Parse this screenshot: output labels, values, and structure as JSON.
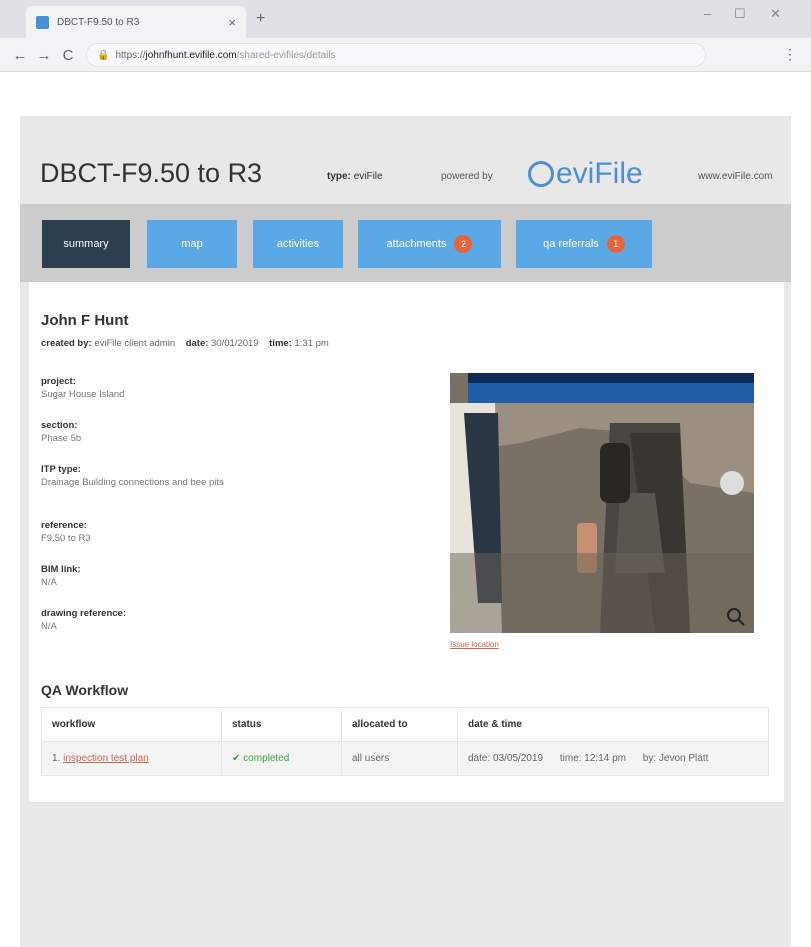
{
  "browser": {
    "tab_title": "DBCT-F9.50 to R3",
    "tab_close": "×",
    "new_tab": "+",
    "window_min": "–",
    "window_max": "☐",
    "window_close": "✕",
    "back": "←",
    "forward": "→",
    "reload": "C",
    "url_scheme": "https://",
    "url_host": "johnfhunt.evifile.com",
    "url_path": "/shared-evifiles/details",
    "menu": "⋮"
  },
  "header": {
    "title": "DBCT-F9.50 to R3",
    "type_label": "type:",
    "type_value": "eviFile",
    "powered_by": "powered by",
    "logo_text": "eviFile",
    "site": "www.eviFile.com",
    "brand_color": "#4a90d9"
  },
  "nav": {
    "tabs": [
      {
        "label": "summary",
        "active": true
      },
      {
        "label": "map"
      },
      {
        "label": "activities"
      },
      {
        "label": "attachments",
        "badge": "2"
      },
      {
        "label": "qa referrals",
        "badge": "1"
      }
    ],
    "active_color": "#2c3e50",
    "tab_color": "#5aa9e6",
    "badge_color": "#e8633a"
  },
  "summary": {
    "name": "John F Hunt",
    "created_by_label": "created by:",
    "created_by": "eviFile client admin",
    "date_label": "date:",
    "date": "30/01/2019",
    "time_label": "time:",
    "time": "1:31 pm",
    "fields": [
      {
        "label": "project:",
        "value": "Sugar House Island"
      },
      {
        "label": "section:",
        "value": "Phase 5b"
      },
      {
        "label": "ITP type:",
        "value": "Drainage Building connections and bee pits"
      },
      {
        "label": "reference:",
        "value": "F9.50 to R3"
      },
      {
        "label": "BIM link:",
        "value": "N/A"
      },
      {
        "label": "drawing reference:",
        "value": "N/A"
      }
    ],
    "photo_link": "Issue location",
    "zoom_icon": "magnifier-icon"
  },
  "qa": {
    "title": "QA Workflow",
    "columns": [
      "workflow",
      "status",
      "allocated to",
      "date & time"
    ],
    "rows": [
      {
        "index": "1.",
        "workflow": "inspection test plan",
        "status_icon": "✔",
        "status": "completed",
        "allocated": "all users",
        "date": "date: 03/05/2019",
        "time": "time: 12:14 pm",
        "by": "by: Jevon Platt"
      }
    ]
  }
}
